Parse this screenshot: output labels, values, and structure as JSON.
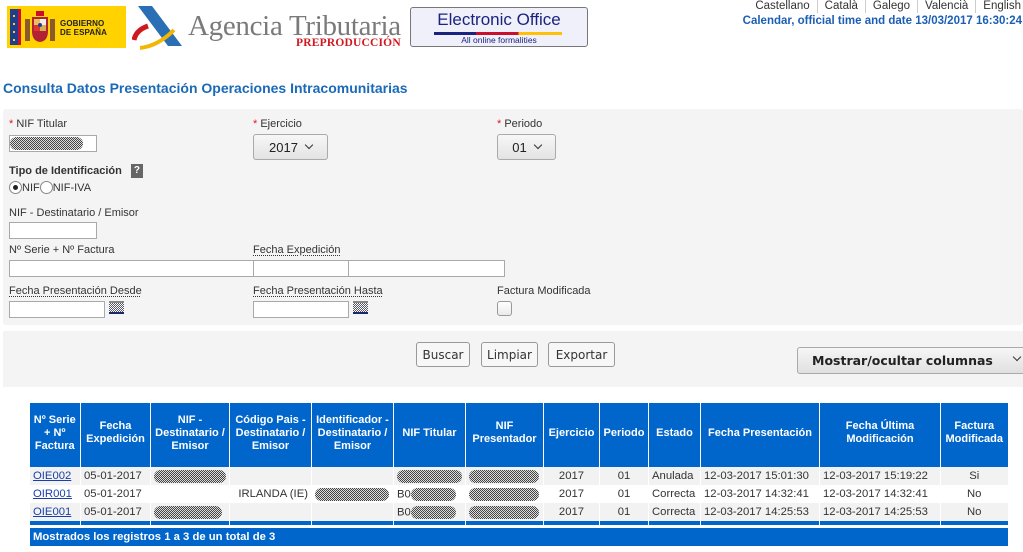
{
  "header": {
    "gov_logo_text": [
      "GOBIERNO",
      "DE ESPAÑA"
    ],
    "agency_name": "Agencia Tributaria",
    "agency_env": "PREPRODUCCIÓN",
    "eoffice_title": "Electronic Office",
    "eoffice_subtitle": "All online formalities",
    "languages": [
      "Castellano",
      "Català",
      "Galego",
      "Valencià",
      "English"
    ],
    "calendar_link": "Calendar, official time and date 13/03/2017 16:30:24"
  },
  "page_title": "Consulta Datos Presentación Operaciones Intracomunitarias",
  "filters": {
    "required_mark": "*",
    "nif_titular_label": "NIF Titular",
    "nif_titular_value": "[redacted]",
    "ejercicio_label": "Ejercicio",
    "ejercicio_value": "2017",
    "periodo_label": "Periodo",
    "periodo_value": "01",
    "tipo_identificacion_label": "Tipo de Identificación",
    "help_glyph": "?",
    "radio_options": [
      {
        "label": "NIF",
        "selected": true
      },
      {
        "label": "NIF-IVA",
        "selected": false
      }
    ],
    "nif_destinatario_label": "NIF - Destinatario / Emisor",
    "nif_destinatario_value": "",
    "serie_factura_label": "Nº Serie + Nº Factura",
    "serie_factura_value": "",
    "fecha_expedicion_label": "Fecha Expedición",
    "fecha_expedicion_value": "",
    "fecha_desde_label": "Fecha Presentación Desde",
    "fecha_desde_value": "",
    "fecha_hasta_label": "Fecha Presentación Hasta",
    "fecha_hasta_value": "",
    "factura_modificada_label": "Factura Modificada",
    "factura_modificada_checked": false
  },
  "actions": {
    "buscar": "Buscar",
    "limpiar": "Limpiar",
    "exportar": "Exportar",
    "columns_toggle": "Mostrar/ocultar columnas"
  },
  "table": {
    "headers": [
      "Nº Serie + Nº Factura",
      "Fecha Expedición",
      "NIF - Destinatario / Emisor",
      "Código Pais - Destinatario / Emisor",
      "Identificador - Destinatario / Emisor",
      "NIF Titular",
      "NIF Presentador",
      "Ejercicio",
      "Periodo",
      "Estado",
      "Fecha Presentación",
      "Fecha Última Modificación",
      "Factura Modificada"
    ],
    "rows": [
      {
        "serie": "OIE002",
        "fecha_expedicion": "05-01-2017",
        "nif_destinatario": "[redacted]",
        "codigo_pais": "",
        "identificador": "",
        "nif_titular_prefix": "",
        "nif_titular": "[redacted]",
        "nif_presentador": "[redacted]",
        "ejercicio": "2017",
        "periodo": "01",
        "estado": "Anulada",
        "fecha_presentacion": "12-03-2017 15:01:30",
        "fecha_ultima": "12-03-2017 15:19:22",
        "modificada": "Si"
      },
      {
        "serie": "OIR001",
        "fecha_expedicion": "05-01-2017",
        "nif_destinatario": "",
        "codigo_pais": "IRLANDA (IE)",
        "identificador": "[redacted]",
        "nif_titular_prefix": "B0",
        "nif_titular": "[redacted]",
        "nif_presentador": "[redacted]",
        "ejercicio": "2017",
        "periodo": "01",
        "estado": "Correcta",
        "fecha_presentacion": "12-03-2017 14:32:41",
        "fecha_ultima": "12-03-2017 14:32:41",
        "modificada": "No"
      },
      {
        "serie": "OIE001",
        "fecha_expedicion": "05-01-2017",
        "nif_destinatario": "[redacted]",
        "codigo_pais": "",
        "identificador": "",
        "nif_titular_prefix": "B0",
        "nif_titular": "[redacted]",
        "nif_presentador": "[redacted]",
        "ejercicio": "2017",
        "periodo": "01",
        "estado": "Correcta",
        "fecha_presentacion": "12-03-2017 14:25:53",
        "fecha_ultima": "12-03-2017 14:25:53",
        "modificada": "No"
      }
    ],
    "footer": "Mostrados los registros 1 a 3 de un total de 3"
  },
  "colors": {
    "brand_blue": "#0066cc",
    "title_blue": "#1a6ab8",
    "required_red": "#e21a1a",
    "panel_gray": "#f4f4f4"
  }
}
